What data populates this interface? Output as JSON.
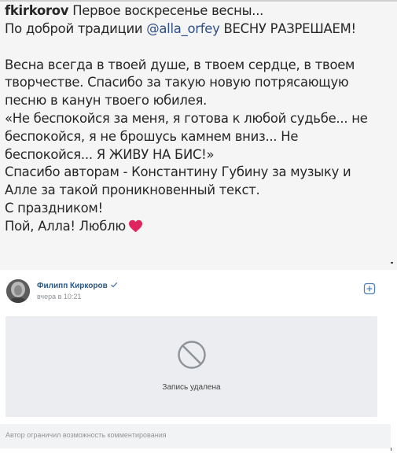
{
  "caption": {
    "username": "fkirkorov",
    "line1_rest": " Первое воскресенье весны...",
    "line2_before": "По доброй традиции ",
    "mention": "@alla_orfey",
    "line2_after": " ВЕСНУ РАЗРЕШАЕМ!",
    "lines": [
      "Весна всегда в твоей душе, в твоем сердце, в твоем",
      "творчестве. Спасибо за такую новую потрясающую",
      "песню в канун твоего юбилея.",
      "«Не беспокойся за меня, я готова к любой судьбе... не",
      "беспокойся, я не брошусь камнем вниз... Не",
      "беспокойся... Я ЖИВУ НА БИС!»",
      "Спасибо авторам - Константину Губину за музыку и",
      "Алле за такой проникновенный текст.",
      "С праздником!"
    ],
    "last_line": "Пой, Алла! Люблю",
    "heart_color": "#e0245e"
  },
  "vk_post": {
    "author_name": "Филипп Киркоров",
    "time": "вчера в 10:21",
    "deleted_text": "Запись удалена",
    "comments_restricted": "Автор ограничил возможность комментирования",
    "link_color": "#2a5885",
    "icons": [
      "verified-icon",
      "add-icon",
      "ban-icon"
    ]
  }
}
